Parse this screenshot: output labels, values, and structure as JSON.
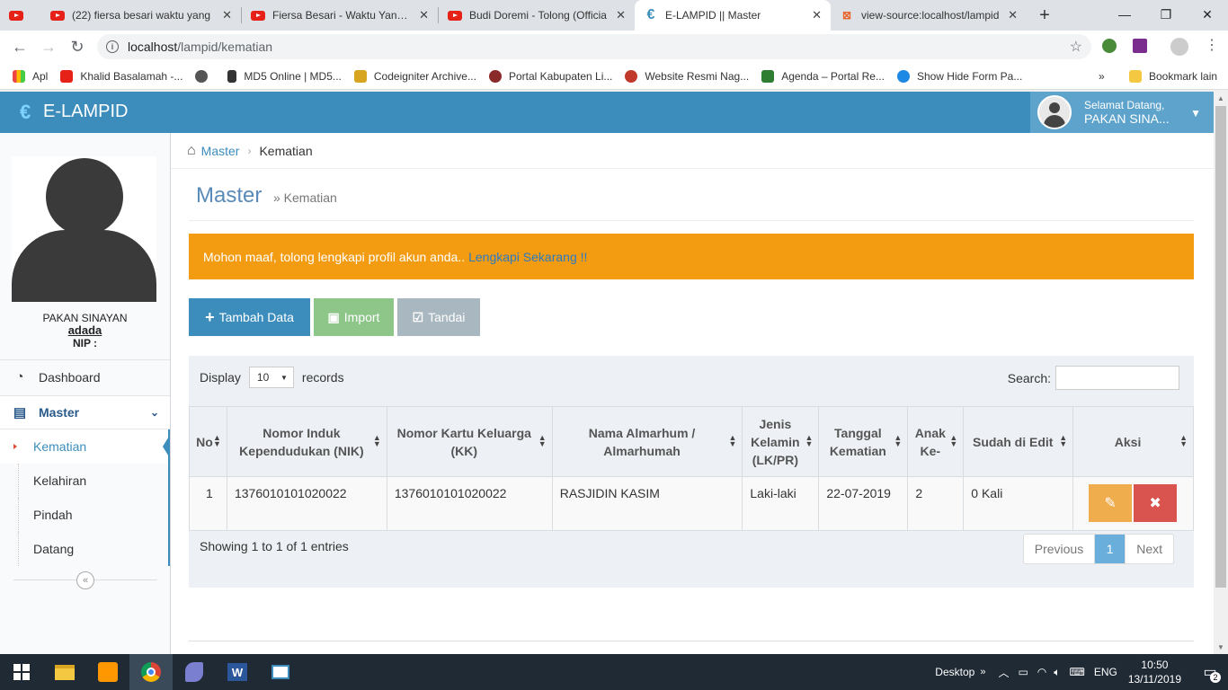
{
  "browser": {
    "tabs": [
      {
        "title": "",
        "icon": "youtube-icon"
      },
      {
        "title": "(22) fiersa besari waktu yang",
        "icon": "youtube-icon"
      },
      {
        "title": "Fiersa Besari - Waktu Yang Sa",
        "icon": "youtube-icon"
      },
      {
        "title": "Budi Doremi - Tolong (Officia",
        "icon": "youtube-icon"
      },
      {
        "title": "E-LAMPID || Master",
        "icon": "elampid-icon",
        "active": true
      },
      {
        "title": "view-source:localhost/lampid",
        "icon": "xampp-icon"
      }
    ],
    "address_host": "localhost",
    "address_path": "/lampid/kematian",
    "bookmarks": [
      {
        "label": "Apl",
        "color": "#e44"
      },
      {
        "label": "Khalid Basalamah -...",
        "color": "#e62117"
      },
      {
        "label": "",
        "color": "#555"
      },
      {
        "label": "MD5 Online | MD5...",
        "color": "#333"
      },
      {
        "label": "Codeigniter Archive...",
        "color": "#d8a520"
      },
      {
        "label": "Portal Kabupaten Li...",
        "color": "#8b2a2a"
      },
      {
        "label": "Website Resmi Nag...",
        "color": "#c0392b"
      },
      {
        "label": "Agenda – Portal Re...",
        "color": "#2e7d32"
      },
      {
        "label": "Show Hide Form Pa...",
        "color": "#1e88e5"
      }
    ],
    "bookmarks_more": "»",
    "other_bookmarks": "Bookmark lain"
  },
  "app": {
    "brand": "E-LAMPID",
    "welcome": "Selamat Datang,",
    "user_name_short": "PAKAN SINA..."
  },
  "sidebar": {
    "profile_name": "PAKAN SINAYAN",
    "username": "adada",
    "nip_label": "NIP :",
    "dashboard": "Dashboard",
    "master": "Master",
    "submenu": [
      "Kematian",
      "Kelahiran",
      "Pindah",
      "Datang"
    ]
  },
  "content": {
    "breadcrumb": {
      "parent": "Master",
      "current": "Kematian"
    },
    "title": "Master",
    "subtitle": "» Kematian",
    "alert_text": "Mohon maaf, tolong lengkapi profil akun anda..",
    "alert_link": "Lengkapi Sekarang !!",
    "btn_add": "Tambah Data",
    "btn_import": "Import",
    "btn_mark": "Tandai",
    "display_label": "Display",
    "display_value": "10",
    "records_label": "records",
    "search_label": "Search:",
    "columns": [
      "No",
      "Nomor Induk Kependudukan (NIK)",
      "Nomor Kartu Keluarga (KK)",
      "Nama Almarhum / Almarhumah",
      "Jenis Kelamin (LK/PR)",
      "Tanggal Kematian",
      "Anak Ke-",
      "Sudah di Edit",
      "Aksi"
    ],
    "rows": [
      [
        "1",
        "1376010101020022",
        "1376010101020022",
        "RASJIDIN KASIM",
        "Laki-laki",
        "22-07-2019",
        "2",
        "0 Kali"
      ]
    ],
    "info": "Showing 1 to 1 of 1 entries",
    "pager": {
      "prev": "Previous",
      "current": "1",
      "next": "Next"
    }
  },
  "taskbar": {
    "desktop_label": "Desktop",
    "lang": "ENG",
    "time": "10:50",
    "date": "13/11/2019",
    "notifications": "2"
  }
}
